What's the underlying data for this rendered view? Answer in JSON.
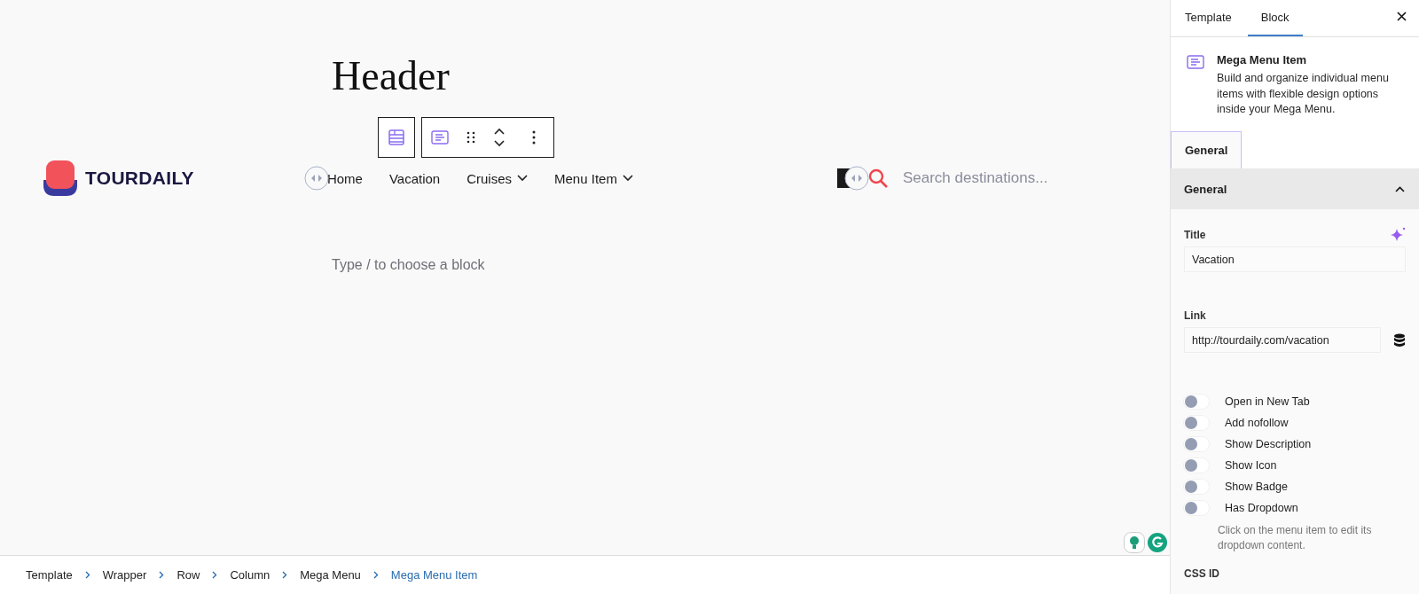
{
  "canvas": {
    "heading": "Header",
    "logo": {
      "text": "TOURDAILY"
    },
    "nav": [
      {
        "label": "Home",
        "dropdown": false
      },
      {
        "label": "Vacation",
        "dropdown": false
      },
      {
        "label": "Cruises",
        "dropdown": true
      },
      {
        "label": "Menu Item",
        "dropdown": true
      }
    ],
    "search": {
      "placeholder": "Search destinations..."
    },
    "block_placeholder": "Type / to choose a block"
  },
  "sidebar": {
    "tabs": [
      {
        "label": "Template",
        "selected": false
      },
      {
        "label": "Block",
        "selected": true
      }
    ],
    "block_card": {
      "title": "Mega Menu Item",
      "description": "Build and organize individual menu items with flexible design options inside your Mega Menu."
    },
    "panel_tabs": [
      {
        "label": "General",
        "selected": true
      }
    ],
    "section": {
      "title": "General",
      "expanded": true
    },
    "fields": [
      {
        "label": "Title",
        "value": "Vacation",
        "kind": "ai"
      },
      {
        "label": "Link",
        "value": "http://tourdaily.com/vacation",
        "kind": "dynamic"
      }
    ],
    "toggles": [
      {
        "label": "Open in New Tab",
        "on": false
      },
      {
        "label": "Add nofollow",
        "on": false
      },
      {
        "label": "Show Description",
        "on": false
      },
      {
        "label": "Show Icon",
        "on": false
      },
      {
        "label": "Show Badge",
        "on": false
      },
      {
        "label": "Has Dropdown",
        "on": false
      }
    ],
    "help": "Click on the menu item to edit its dropdown content.",
    "css_id_label": "CSS ID"
  },
  "breadcrumbs": [
    {
      "label": "Template",
      "selected": false
    },
    {
      "label": "Wrapper",
      "selected": false
    },
    {
      "label": "Row",
      "selected": false
    },
    {
      "label": "Column",
      "selected": false
    },
    {
      "label": "Mega Menu",
      "selected": false
    },
    {
      "label": "Mega Menu Item",
      "selected": true
    }
  ]
}
